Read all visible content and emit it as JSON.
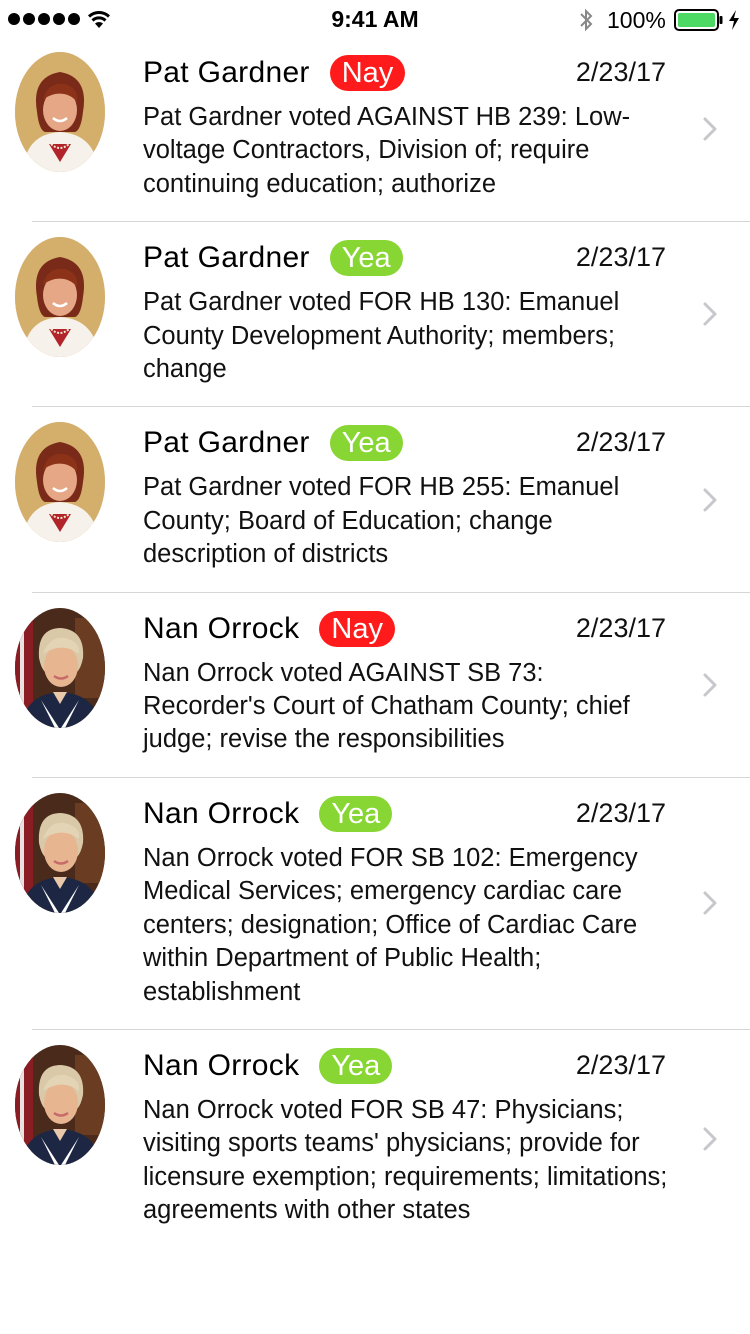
{
  "status_bar": {
    "time": "9:41 AM",
    "battery": "100%"
  },
  "scroll_fragment": "authorize",
  "colors": {
    "nay": "#ff1b1b",
    "yea": "#88d633",
    "divider": "#d6d6d6",
    "chevron": "#c7c7cc",
    "battery": "#4cd964"
  },
  "votes": [
    {
      "name": "Pat Gardner",
      "vote": "Nay",
      "date": "2/23/17",
      "description": "Pat Gardner voted AGAINST HB 239: Low-voltage Contractors, Division of; require continuing education; authorize",
      "avatar_icon": "pat-gardner-photo"
    },
    {
      "name": "Pat Gardner",
      "vote": "Yea",
      "date": "2/23/17",
      "description": "Pat Gardner voted FOR HB 130: Emanuel County Development Authority; members; change",
      "avatar_icon": "pat-gardner-photo"
    },
    {
      "name": "Pat Gardner",
      "vote": "Yea",
      "date": "2/23/17",
      "description": "Pat Gardner voted FOR HB 255: Emanuel County; Board of Education; change description of districts",
      "avatar_icon": "pat-gardner-photo"
    },
    {
      "name": "Nan Orrock",
      "vote": "Nay",
      "date": "2/23/17",
      "description": "Nan Orrock voted AGAINST SB 73: Recorder's Court of Chatham County; chief judge; revise the responsibilities",
      "avatar_icon": "nan-orrock-photo"
    },
    {
      "name": "Nan Orrock",
      "vote": "Yea",
      "date": "2/23/17",
      "description": "Nan Orrock voted FOR SB 102: Emergency Medical Services; emergency cardiac care centers; designation; Office of Cardiac Care within Department of Public Health; establishment",
      "avatar_icon": "nan-orrock-photo"
    },
    {
      "name": "Nan Orrock",
      "vote": "Yea",
      "date": "2/23/17",
      "description": "Nan Orrock voted FOR SB 47: Physicians; visiting sports teams' physicians; provide for licensure exemption; requirements; limitations; agreements with other states",
      "avatar_icon": "nan-orrock-photo"
    }
  ]
}
